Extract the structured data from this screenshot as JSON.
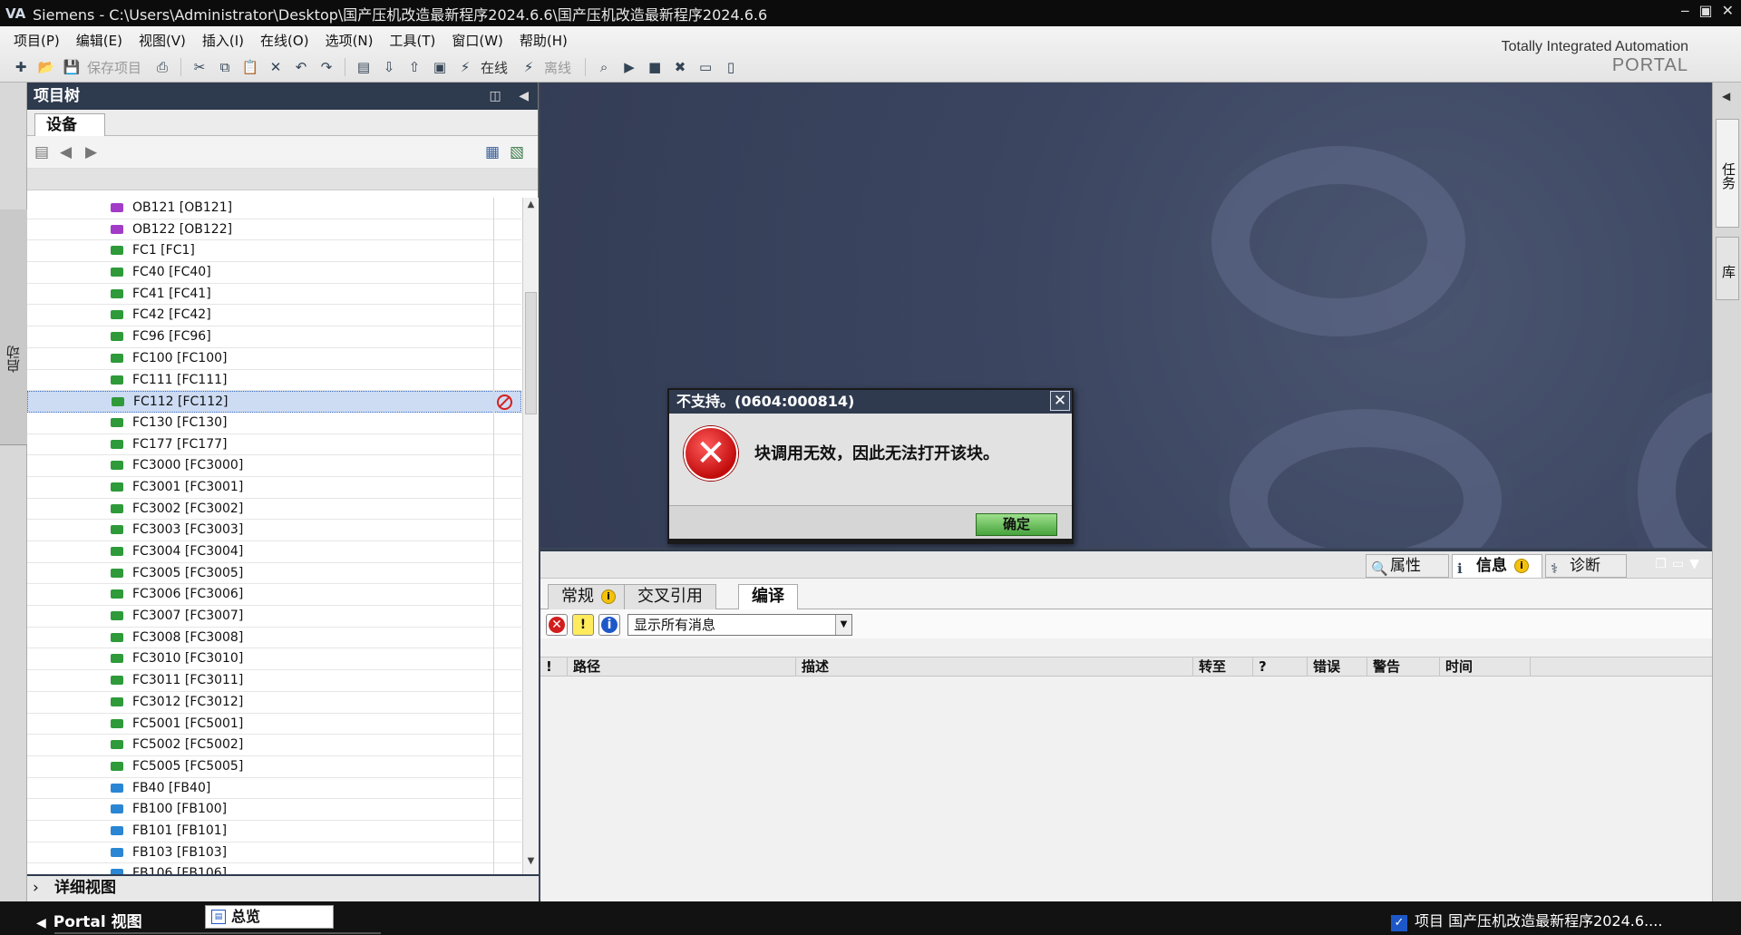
{
  "titlebar": {
    "app": "Siemens",
    "path": " - C:\\Users\\Administrator\\Desktop\\国产压机改造最新程序2024.6.6\\国产压机改造最新程序2024.6.6"
  },
  "menu": [
    "项目(P)",
    "编辑(E)",
    "视图(V)",
    "插入(I)",
    "在线(O)",
    "选项(N)",
    "工具(T)",
    "窗口(W)",
    "帮助(H)"
  ],
  "toolbar": {
    "save_label": "保存项目",
    "online_label": "在线",
    "offline_label": "离线"
  },
  "brand": {
    "line1": "Totally Integrated Automation",
    "line2": "PORTAL"
  },
  "left_strip": {
    "label": "启动"
  },
  "project_tree": {
    "title": "项目树",
    "tab": "设备",
    "items": [
      {
        "label": "OB121 [OB121]",
        "type": "ob"
      },
      {
        "label": "OB122 [OB122]",
        "type": "ob"
      },
      {
        "label": "FC1 [FC1]",
        "type": "fc"
      },
      {
        "label": "FC40 [FC40]",
        "type": "fc"
      },
      {
        "label": "FC41 [FC41]",
        "type": "fc"
      },
      {
        "label": "FC42 [FC42]",
        "type": "fc"
      },
      {
        "label": "FC96 [FC96]",
        "type": "fc"
      },
      {
        "label": "FC100 [FC100]",
        "type": "fc"
      },
      {
        "label": "FC111 [FC111]",
        "type": "fc"
      },
      {
        "label": "FC112 [FC112]",
        "type": "fc"
      },
      {
        "label": "FC130 [FC130]",
        "type": "fc"
      },
      {
        "label": "FC177 [FC177]",
        "type": "fc"
      },
      {
        "label": "FC3000 [FC3000]",
        "type": "fc"
      },
      {
        "label": "FC3001 [FC3001]",
        "type": "fc"
      },
      {
        "label": "FC3002 [FC3002]",
        "type": "fc"
      },
      {
        "label": "FC3003 [FC3003]",
        "type": "fc"
      },
      {
        "label": "FC3004 [FC3004]",
        "type": "fc"
      },
      {
        "label": "FC3005 [FC3005]",
        "type": "fc"
      },
      {
        "label": "FC3006 [FC3006]",
        "type": "fc"
      },
      {
        "label": "FC3007 [FC3007]",
        "type": "fc"
      },
      {
        "label": "FC3008 [FC3008]",
        "type": "fc"
      },
      {
        "label": "FC3010 [FC3010]",
        "type": "fc"
      },
      {
        "label": "FC3011 [FC3011]",
        "type": "fc"
      },
      {
        "label": "FC3012 [FC3012]",
        "type": "fc"
      },
      {
        "label": "FC5001 [FC5001]",
        "type": "fc"
      },
      {
        "label": "FC5002 [FC5002]",
        "type": "fc"
      },
      {
        "label": "FC5005 [FC5005]",
        "type": "fc"
      },
      {
        "label": "FB40 [FB40]",
        "type": "fb"
      },
      {
        "label": "FB100 [FB100]",
        "type": "fb"
      },
      {
        "label": "FB101 [FB101]",
        "type": "fb"
      },
      {
        "label": "FB103 [FB103]",
        "type": "fb"
      },
      {
        "label": "FB106 [FB106]",
        "type": "fb"
      }
    ],
    "selected_index": 9,
    "detail_view": "详细视图"
  },
  "dialog": {
    "title": "不支持。(0604:000814)",
    "message": "块调用无效，因此无法打开该块。",
    "ok": "确定"
  },
  "inspector": {
    "tabs": [
      "属性",
      "信息",
      "诊断"
    ],
    "active_tab": "信息",
    "subtabs": [
      "常规",
      "交叉引用",
      "编译"
    ],
    "active_subtab": "编译",
    "filter": "显示所有消息",
    "columns": [
      "!",
      "路径",
      "描述",
      "转至",
      "?",
      "错误",
      "警告",
      "时间"
    ]
  },
  "right_strip": {
    "tasks": "任务",
    "libs": "库"
  },
  "bottombar": {
    "portal_view": "Portal 视图",
    "overview": "总览",
    "status": "项目 国产压机改造最新程序2024.6...."
  }
}
